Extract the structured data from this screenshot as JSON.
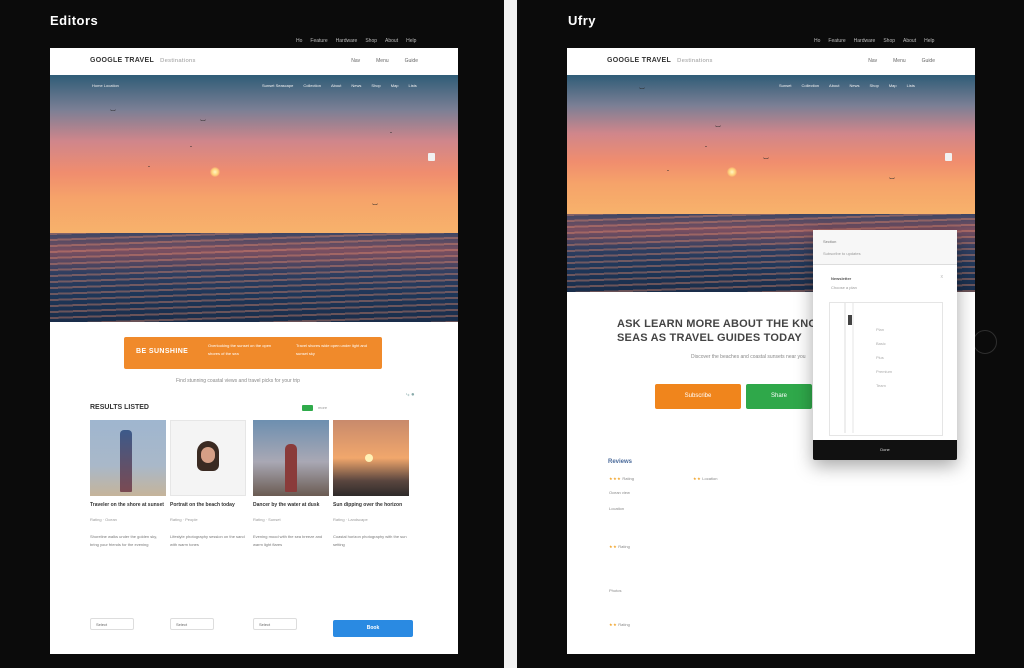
{
  "left_window": {
    "app_title": "Editors",
    "toplinks": [
      "Ho",
      "Feature",
      "Hardware",
      "Shop",
      "About",
      "Help"
    ],
    "brand": "GOOGLE TRAVEL",
    "brand_sub": "Destinations",
    "navlinks": [
      "Nav",
      "Menu",
      "Guide"
    ],
    "hero_left": "Home  Location",
    "hero_nav": [
      "Sunset Seascape",
      "Collection",
      "About",
      "News",
      "Shop",
      "Map",
      "Lists"
    ],
    "banner": {
      "title": "BE  SUNSHINE",
      "text_a": "Overlooking the sunset on the open shores of the sea",
      "text_b": "Travel shores wide open under light and sunset sky"
    },
    "tagline": "Find stunning coastal views and travel picks for your trip",
    "section_title": "RESULTS LISTED",
    "pill_label": "more",
    "cards": [
      {
        "title": "Traveler on the shore at sunset",
        "meta": "Rating  ·  Ocean",
        "desc": "Shoreline walks under the golden sky, bring your friends for the evening",
        "select": "Select"
      },
      {
        "title": "Portrait on the beach today",
        "meta": "Rating  ·  People",
        "desc": "Lifestyle photography session on the sand with warm tones",
        "select": "Select"
      },
      {
        "title": "Dancer by the water at dusk",
        "meta": "Rating  ·  Sunset",
        "desc": "Evening mood with the sea breeze and warm light flares",
        "select": "Select"
      },
      {
        "title": "Sun dipping over the horizon",
        "meta": "Rating  ·  Landscape",
        "desc": "Coastal horizon photography with the sun setting",
        "select": ""
      }
    ],
    "blue_button": "Book"
  },
  "right_window": {
    "app_title": "Ufry",
    "toplinks": [
      "Ho",
      "Feature",
      "Hardware",
      "Shop",
      "About",
      "Help"
    ],
    "brand": "GOOGLE TRAVEL",
    "brand_sub": "Destinations",
    "navlinks": [
      "Nav",
      "Menu",
      "Guide"
    ],
    "hero_nav": [
      "Sunset",
      "Collection",
      "About",
      "News",
      "Shop",
      "Map",
      "Lists"
    ],
    "headline": "ASK LEARN MORE ABOUT THE KNOWN SEAS AS TRAVEL GUIDES TODAY",
    "subline": "Discover the beaches and coastal sunsets near you",
    "btn_orange": "Subscribe",
    "btn_green": "Share",
    "list_title": "Reviews",
    "list_items": [
      "Rating",
      "Ocean view",
      "Location",
      "Rating",
      "Photos",
      "Rating",
      "Location"
    ],
    "modal": {
      "header_a": "Section",
      "header_b": "Subscribe to updates",
      "sub_title": "Newsletter",
      "sub_text": "Choose a plan",
      "close": "x",
      "lines": [
        "Plan",
        "Basic",
        "Plus",
        "Premium",
        "Team"
      ],
      "footer": "Done"
    }
  },
  "colors": {
    "orange": "#f08a2b",
    "green": "#2fa84a",
    "blue": "#2a8ae2",
    "star": "#f1a020"
  }
}
